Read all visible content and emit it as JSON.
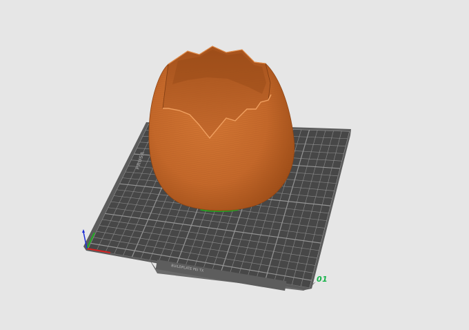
{
  "scene": {
    "background": "#e6e6e6",
    "plate": {
      "number": "01",
      "number_color": "#17b24a",
      "surface_color": "#4a4a4a",
      "grid_color": "#9a9a9a",
      "frame_color": "#5a5a5a",
      "front_label": "BUILDPLATE PEI TX",
      "side_label": "PRUSA"
    },
    "model": {
      "name": "cracked egg shell",
      "color": "#c4682a",
      "selected": true
    },
    "axes": {
      "x_color": "#d42121",
      "y_color": "#1fae1f",
      "z_color": "#1b2bd6"
    }
  }
}
